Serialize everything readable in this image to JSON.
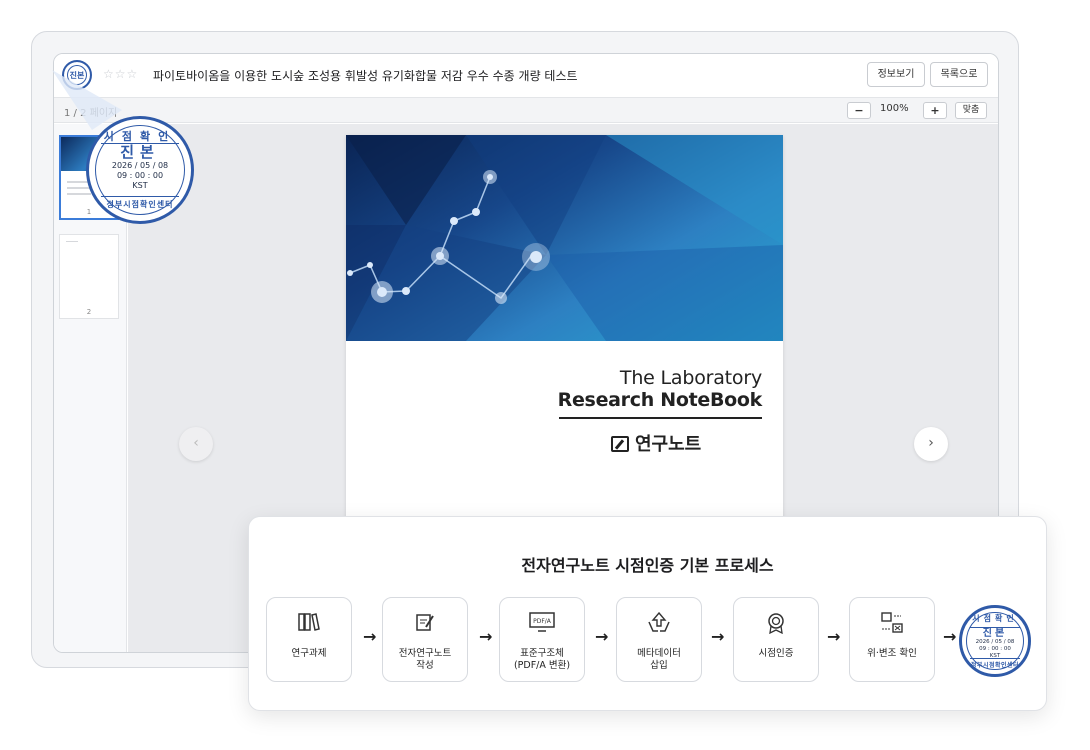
{
  "viewer": {
    "seal_label": "진본",
    "stars": "☆☆☆",
    "title": "파이토바이옴을 이용한 도시숲 조성용 휘발성 유기화합물 저감 우수 수종 개량 테스트",
    "info_button": "정보보기",
    "list_button": "목록으로",
    "page_indicator": "1 / 2 페이지",
    "zoom_minus": "−",
    "zoom_value": "100%",
    "zoom_plus": "+",
    "zoom_fit": "맞춤",
    "thumbnails": [
      {
        "number": "1"
      },
      {
        "number": "2"
      }
    ],
    "nav_prev": "‹",
    "nav_next": "›"
  },
  "cover": {
    "line1": "The Laboratory",
    "line2": "Research NoteBook",
    "line3": "연구노트"
  },
  "seal": {
    "top_text": "시점확인",
    "main_text": "진본",
    "date": "2026 / 05 / 08",
    "time": "09 : 00 : 00",
    "zone": "KST",
    "bottom_text": "정부시점확인센터"
  },
  "seal_end": {
    "top_text": "시점확인",
    "main_text": "진본",
    "date": "2026 / 05 / 08",
    "time": "09 : 00 : 00",
    "zone": "KST",
    "bottom_text": "정부시점확인센터"
  },
  "process": {
    "title": "전자연구노트 시점인증 기본 프로세스",
    "steps": [
      {
        "icon": "binders-icon",
        "line1": "연구과제",
        "line2": ""
      },
      {
        "icon": "note-edit-icon",
        "line1": "전자연구노트",
        "line2": "작성"
      },
      {
        "icon": "pdfa-monitor-icon",
        "line1": "표준구조체",
        "line2": "(PDF/A 변환)"
      },
      {
        "icon": "hands-upload-icon",
        "line1": "메타데이터",
        "line2": "삽입"
      },
      {
        "icon": "award-badge-icon",
        "line1": "시점인증",
        "line2": ""
      },
      {
        "icon": "verify-compare-icon",
        "line1": "위·변조 확인",
        "line2": ""
      }
    ],
    "arrow": "→"
  }
}
